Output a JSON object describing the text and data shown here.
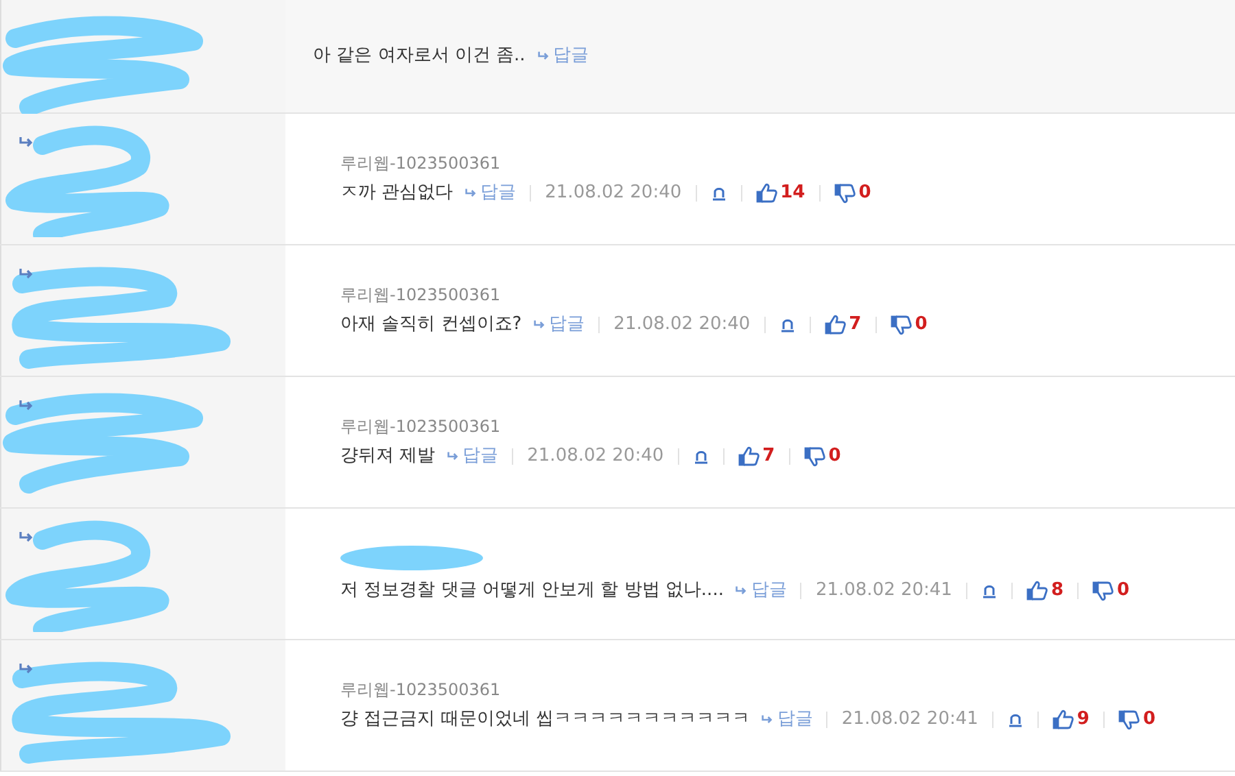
{
  "comments": [
    {
      "is_reply": false,
      "highlighted": true,
      "text": "아 같은 여자로서 이건 좀..",
      "reply_label": "답글"
    },
    {
      "is_reply": true,
      "highlighted": false,
      "author": "루리웹-1023500361",
      "text": "ㅈ까 관심없다",
      "reply_label": "답글",
      "time": "21.08.02 20:40",
      "likes": "14",
      "dislikes": "0"
    },
    {
      "is_reply": true,
      "highlighted": false,
      "author": "루리웹-1023500361",
      "text": "아재 솔직히 컨셉이죠?",
      "reply_label": "답글",
      "time": "21.08.02 20:40",
      "likes": "7",
      "dislikes": "0"
    },
    {
      "is_reply": true,
      "highlighted": false,
      "author": "루리웹-1023500361",
      "text": "걍뒤져 제발",
      "reply_label": "답글",
      "time": "21.08.02 20:40",
      "likes": "7",
      "dislikes": "0"
    },
    {
      "is_reply": true,
      "highlighted": false,
      "text": "저 정보경찰 댓글 어떻게 안보게 할 방법 없나....",
      "reply_label": "답글",
      "time": "21.08.02 20:41",
      "likes": "8",
      "dislikes": "0"
    },
    {
      "is_reply": true,
      "highlighted": false,
      "author": "루리웹-1023500361",
      "text": "걍 접근금지 때문이었네 씹ㅋㅋㅋㅋㅋㅋㅋㅋㅋㅋㅋ",
      "reply_label": "답글",
      "time": "21.08.02 20:41",
      "likes": "9",
      "dislikes": "0"
    }
  ]
}
